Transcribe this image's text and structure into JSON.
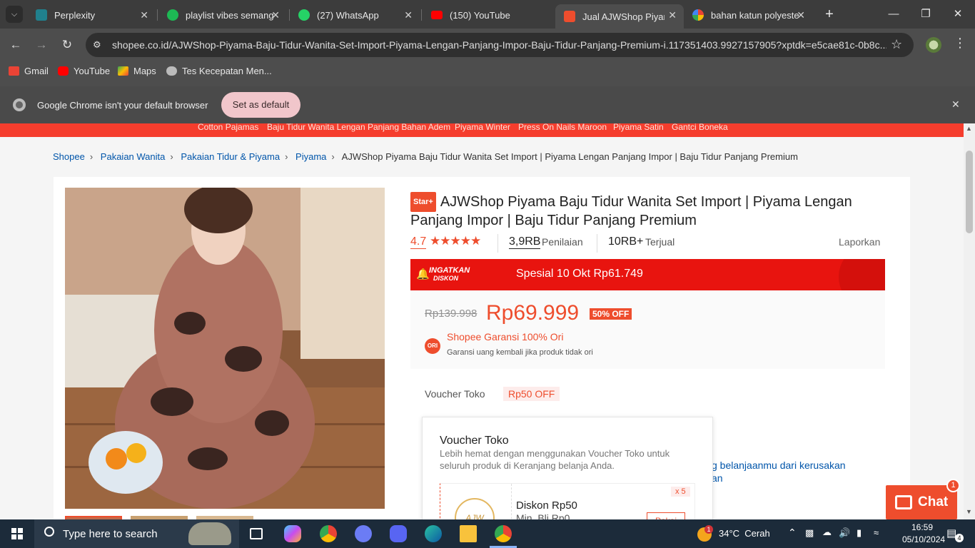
{
  "browser": {
    "tabs": [
      {
        "title": "Perplexity",
        "icon": "perplexity-icon",
        "color": "#20808d"
      },
      {
        "title": "playlist vibes semang",
        "icon": "spotify-icon",
        "color": "#1db954"
      },
      {
        "title": "(27) WhatsApp",
        "icon": "whatsapp-icon",
        "color": "#25d366"
      },
      {
        "title": "(150) YouTube",
        "icon": "youtube-icon",
        "color": "#ff0000"
      },
      {
        "title": "Jual AJWShop Piyama",
        "icon": "shopee-icon",
        "color": "#ee4d2d"
      },
      {
        "title": "bahan katun polyeste",
        "icon": "google-icon",
        "color": "#4285f4"
      }
    ],
    "url": "shopee.co.id/AJWShop-Piyama-Baju-Tidur-Wanita-Set-Import-Piyama-Lengan-Panjang-Impor-Baju-Tidur-Panjang-Premium-i.117351403.9927157905?xptdk=e5cae81c-0b8c...",
    "bookmarks": [
      {
        "label": "Gmail",
        "icon": "gmail-icon"
      },
      {
        "label": "YouTube",
        "icon": "youtube-icon"
      },
      {
        "label": "Maps",
        "icon": "maps-icon"
      },
      {
        "label": "Tes Kecepatan Men...",
        "icon": "globe-icon"
      }
    ],
    "infobar": {
      "message": "Google Chrome isn't your default browser",
      "button": "Set as default"
    }
  },
  "page": {
    "top_links": [
      "Cotton Pajamas",
      "Baju Tidur Wanita Lengan Panjang Bahan Adem",
      "Piyama Winter",
      "Press On Nails Maroon",
      "Piyama Satin",
      "Gantci Boneka"
    ],
    "breadcrumbs": [
      "Shopee",
      "Pakaian Wanita",
      "Pakaian Tidur & Piyama",
      "Piyama"
    ],
    "breadcrumb_current": "AJWShop Piyama Baju Tidur Wanita Set Import | Piyama Lengan Panjang Impor | Baju Tidur Panjang Premium",
    "product": {
      "badge": "Star+",
      "title": "AJWShop Piyama Baju Tidur Wanita Set Import | Piyama Lengan Panjang Impor | Baju Tidur Panjang Premium",
      "rating": "4.7",
      "rating_stars": 4.7,
      "reviews_count": "3,9RB",
      "reviews_label": "Penilaian",
      "sold_count": "10RB+",
      "sold_label": "Terjual",
      "report": "Laporkan",
      "flash_badge_line1": "INGATKAN",
      "flash_badge_line2": "DISKON",
      "flash_text": "Spesial 10 Okt Rp61.749",
      "original_price": "Rp139.998",
      "price": "Rp69.999",
      "discount": "50% OFF",
      "ori_badge": "ORI",
      "guarantee_title": "Shopee Garansi 100% Ori",
      "guarantee_sub": "Garansi uang kembali jika produk tidak ori",
      "voucher_label": "Voucher Toko",
      "voucher_chip": "Rp50 OFF",
      "protection_text_1": "g belanjaanmu dari kerusakan",
      "protection_text_2": "an"
    },
    "voucher_panel": {
      "title": "Voucher Toko",
      "description": "Lebih hemat dengan menggunakan Voucher Toko untuk seluruh produk di Keranjang belanja Anda.",
      "item_title": "Diskon Rp50",
      "item_sub": "Min. Blj Rp0",
      "item_qty": "x 5",
      "item_button": "Pakai",
      "logo_text": "AJW"
    },
    "chat": {
      "label": "Chat",
      "badge": "1"
    }
  },
  "taskbar": {
    "search_placeholder": "Type here to search",
    "weather": "34°C  Cerah",
    "weather_badge": "1",
    "time": "16:59",
    "date": "05/10/2024",
    "notif_count": "4"
  }
}
